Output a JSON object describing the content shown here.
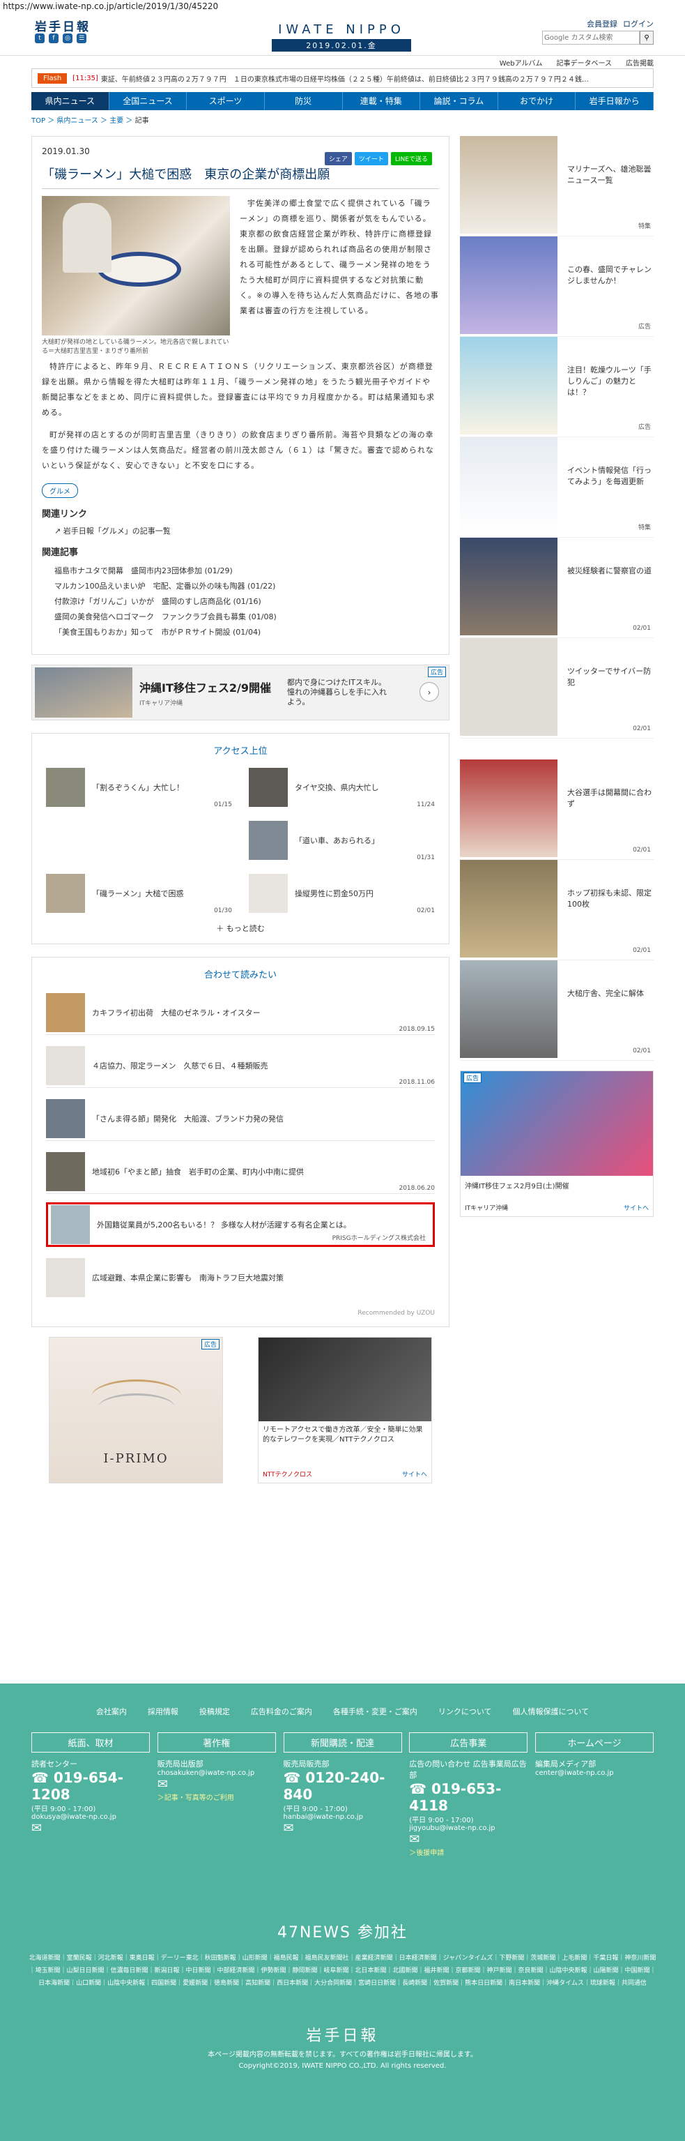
{
  "url": "https://www.iwate-np.co.jp/article/2019/1/30/45220",
  "header": {
    "logo": "岩手日報",
    "brand": "IWATE NIPPO",
    "date": "2019.02.01.金",
    "login": "ログイン",
    "register": "会員登録",
    "search_placeholder": "Google カスタム検索"
  },
  "subnav": [
    "Webアルバム",
    "記事データベース",
    "広告掲載"
  ],
  "flash": {
    "tag": "Flash",
    "time": "[11:35]",
    "text": "東証、午前終値２３円高の２万７９７円　１日の東京株式市場の日経平均株価（２２５種）午前終値は、前日終値比２３円７９銭高の２万７９７円２４銭…"
  },
  "nav": [
    "県内ニュース",
    "全国ニュース",
    "スポーツ",
    "防災",
    "連載・特集",
    "論説・コラム",
    "おでかけ",
    "岩手日報から"
  ],
  "breadcrumb": {
    "top": "TOP",
    "cat": "県内ニュース",
    "sub": "主要",
    "current": "記事"
  },
  "article": {
    "date": "2019.01.30",
    "share": [
      "シェア",
      "ツイート",
      "LINEで送る"
    ],
    "title": "「磯ラーメン」大槌で困惑　東京の企業が商標出願",
    "caption": "大槌町が発祥の地としている磯ラーメン。地元各店で親しまれている＝大槌町吉里吉里・まりぎり番所前",
    "paragraphs": [
      "宇佐美洋の郷土食堂で広く提供されている「磯ラーメン」の商標を巡り、関係者が気をもんでいる。東京都の飲食店経営企業が昨秋、特許庁に商標登録を出願。登録が認められれば商品名の使用が制限される可能性があるとして、磯ラーメン発祥の地をうたう大槌町が同庁に資料提供するなど対抗策に動く。※の導入を待ち込んだ人気商品だけに、各地の事業者は審査の行方を注視している。",
      "特許庁によると、昨年９月、ＲＥＣＲＥＡＴＩＯＮＳ（リクリエーションズ、東京都渋谷区）が商標登録を出願。県から情報を得た大槌町は昨年１１月、「磯ラーメン発祥の地」をうたう観光冊子やガイドや新聞記事などをまとめ、同庁に資料提供した。登録審査には平均で９カ月程度かかる。町は結果通知も求める。",
      "町が発祥の店とするのが同町吉里吉里（きりきり）の飲食店まりぎり番所前。海苔や貝類などの海の幸を盛り付けた磯ラーメンは人気商品だ。経営者の前川茂太郎さん（６１）は「驚きだ。審査で認められないという保証がなく、安心できない」と不安を口にする。"
    ],
    "tag": "グルメ",
    "related_link_title": "関連リンク",
    "related_link": "岩手日報「グルメ」の記事一覧",
    "related_title": "関連記事",
    "related": [
      "福島市ナユタで開幕　盛岡市内23団体参加 (01/29)",
      "マルカン100品えいまい炉　宅配、定番以外の味も陶器 (01/22)",
      "付款涼け「ガリんご」いかが　盛岡のすし店商品化 (01/16)",
      "盛岡の美食発信へロゴマーク　ファンクラブ会員も募集 (01/08)",
      "「美食王国もりおか」知って　市がＰＲサイト開設 (01/04)"
    ]
  },
  "ad1": {
    "title": "沖縄IT移住フェス2/9開催",
    "sub": "ITキャリア沖縄",
    "desc": "都内で身につけたITスキル。憧れの沖縄暮らしを手に入れよう。",
    "badge": "広告"
  },
  "access": {
    "title": "アクセス上位",
    "items": [
      {
        "text": "「割るぞうくん」大忙し！",
        "date": "01/15"
      },
      {
        "text": "タイヤ交換、県内大忙し",
        "date": "11/24"
      },
      {
        "text": "",
        "date": ""
      },
      {
        "text": "「道い車、あおられる」",
        "date": "01/31"
      },
      {
        "text": "「磯ラーメン」大槌で困惑",
        "date": "01/30"
      },
      {
        "text": "操縦男性に罰金50万円",
        "date": "02/01"
      }
    ],
    "more": "もっと読む"
  },
  "read": {
    "title": "合わせて読みたい",
    "items": [
      {
        "text": "カキフライ初出荷　大槌のゼネラル・オイスター",
        "date": "2018.09.15"
      },
      {
        "text": "４店協力、限定ラーメン　久慈で６日、４種類販売",
        "date": "2018.11.06"
      },
      {
        "text": "「さんま得る節」開発化　大船渡、ブランド力発の発信",
        "date": ""
      },
      {
        "text": "地域初6「やまと節」抽食　岩手町の企業、町内小中南に提供",
        "date": "2018.06.20"
      }
    ],
    "promo": {
      "text": "外国籍従業員が5,200名もいる！？ 多様な人材が活躍する有名企業とは。",
      "source": "PRISGホールディングス株式会社"
    },
    "last": "広域避難、本県企業に影響も　南海トラフ巨大地震対策",
    "recommended": "Recommended by UZOU"
  },
  "bottom_ads": [
    {
      "name": "I-PRIMO",
      "badge": "広告"
    },
    {
      "name": "リモートアクセスで働き方改革／安全・簡単に効果的なテレワークを実現／NTTテクノクロス",
      "source": "NTTテクノクロス",
      "link": "サイトへ"
    }
  ],
  "sidebar": [
    {
      "text": "マリナーズへ、雄池聡曇ニュース一覧",
      "cat": "特集"
    },
    {
      "text": "この春、盛岡でチャレンジしませんか！",
      "cat": "広告"
    },
    {
      "text": "注目！乾燥ウルーツ「手しりんご」の魅力とは！？",
      "cat": "広告"
    },
    {
      "text": "イベント情報発信「行ってみよう」を毎週更新",
      "cat": "特集"
    },
    {
      "text": "被災経験者に警察官の道",
      "cat": "02/01"
    },
    {
      "text": "ツイッターでサイバー防犯",
      "cat": "02/01"
    },
    {
      "text": "大谷選手は開幕間に合わず",
      "cat": "02/01"
    },
    {
      "text": "ホップ初採も未認、限定100枚",
      "cat": "02/01"
    },
    {
      "text": "大槌庁舎、完全に解体",
      "cat": "02/01"
    }
  ],
  "side_ad": {
    "title": "沖縄IT移住フェス2月9日(土)開催",
    "sub": "ITキャリア沖縄",
    "link": "サイトへ",
    "badge": "広告"
  },
  "footer": {
    "links": [
      "会社案内",
      "採用情報",
      "投稿規定",
      "広告料金のご案内",
      "各種手続・変更・ご案内",
      "リンクについて",
      "個人情報保護について"
    ],
    "cols": [
      {
        "btn": "紙面、取材",
        "label": "読者センター",
        "tel": "019-654-1208",
        "hours": "(平日 9:00 - 17:00)",
        "mail": "dokusya@iwate-np.co.jp",
        "extra": ""
      },
      {
        "btn": "著作権",
        "label": "販売局出版部",
        "tel": "",
        "hours": "",
        "mail": "chosakuken@iwate-np.co.jp",
        "extra": "＞記事・写真等のご利用"
      },
      {
        "btn": "新聞購読・配達",
        "label": "販売局販売部",
        "tel": "0120-240-840",
        "hours": "(平日 9:00 - 17:00)",
        "mail": "hanbai@iwate-np.co.jp",
        "extra": ""
      },
      {
        "btn": "広告事業",
        "label": "広告の問い合わせ 広告事業局広告部",
        "tel": "019-653-4118",
        "hours": "(平日 9:00 - 17:00)",
        "mail": "jigyoubu@iwate-np.co.jp",
        "extra": "＞後援申請"
      },
      {
        "btn": "ホームページ",
        "label": "編集局メディア部",
        "tel": "",
        "hours": "",
        "mail": "center@iwate-np.co.jp",
        "extra": ""
      }
    ],
    "n47": "47NEWS 参加社",
    "papers": "北海道新聞｜室蘭民報｜河北新報｜東奥日報｜デーリー東北｜秋田魁新報｜山形新聞｜福島民報｜福島民友新聞社｜産業経済新聞｜日本経済新聞｜ジャパンタイムズ｜下野新聞｜茨城新聞｜上毛新聞｜千葉日報｜神奈川新聞｜埼玉新聞｜山梨日日新聞｜信濃毎日新聞｜新潟日報｜中日新聞｜中部経済新聞｜伊勢新聞｜静岡新聞｜岐阜新聞｜北日本新聞｜北國新聞｜福井新聞｜京都新聞｜神戸新聞｜奈良新聞｜山陰中央新報｜山陽新聞｜中国新聞｜日本海新聞｜山口新聞｜山陰中央新報｜四国新聞｜愛媛新聞｜徳島新聞｜高知新聞｜西日本新聞｜大分合同新聞｜宮崎日日新聞｜長崎新聞｜佐賀新聞｜熊本日日新聞｜南日本新聞｜沖縄タイムス｜琉球新報｜共同通信",
    "logo": "岩手日報",
    "notice": "本ページ掲載内容の無断転載を禁じます。すべての著作権は岩手日報社に帰属します。",
    "copyright": "Copyright©2019, IWATE NIPPO CO.,LTD. All rights reserved."
  }
}
